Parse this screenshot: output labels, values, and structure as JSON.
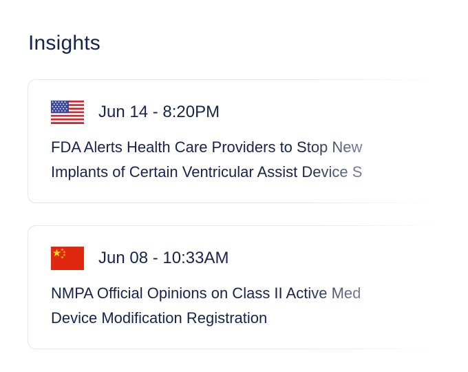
{
  "section": {
    "title": "Insights"
  },
  "insights": [
    {
      "country_icon": "us-flag-icon",
      "date": "Jun 14 - 8:20PM",
      "title_line1": "FDA Alerts Health Care Providers to Stop New",
      "title_line2": "Implants of Certain Ventricular Assist Device S"
    },
    {
      "country_icon": "china-flag-icon",
      "date": "Jun 08 - 10:33AM",
      "title_line1": "NMPA Official Opinions on Class II Active Med",
      "title_line2": "Device Modification Registration"
    }
  ],
  "colors": {
    "text": "#16234a",
    "card_border": "#e4e6ea",
    "us_red": "#d2232a",
    "us_blue": "#3b4a9c",
    "china_red": "#de2910",
    "china_star": "#ffde00"
  }
}
